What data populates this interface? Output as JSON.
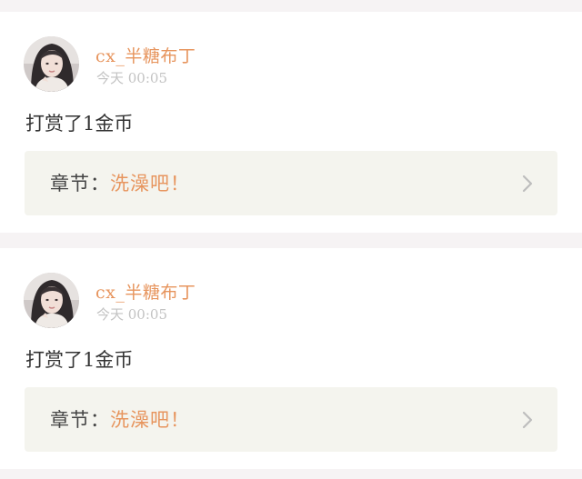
{
  "feed": {
    "items": [
      {
        "username": "cx_半糖布丁",
        "timestamp": "今天 00:05",
        "message": "打赏了1金币",
        "chapter_prefix": "章节：",
        "chapter_title": "洗澡吧！",
        "avatar_icon": "user-avatar-photo",
        "arrow_icon": "chevron-right-icon"
      },
      {
        "username": "cx_半糖布丁",
        "timestamp": "今天 00:05",
        "message": "打赏了1金币",
        "chapter_prefix": "章节：",
        "chapter_title": "洗澡吧！",
        "avatar_icon": "user-avatar-photo",
        "arrow_icon": "chevron-right-icon"
      }
    ]
  },
  "colors": {
    "page_background": "#f6f3f4",
    "card_background": "#ffffff",
    "accent": "#e7955e",
    "timestamp": "#c3c3c3",
    "chapter_box": "#f4f4ee"
  }
}
